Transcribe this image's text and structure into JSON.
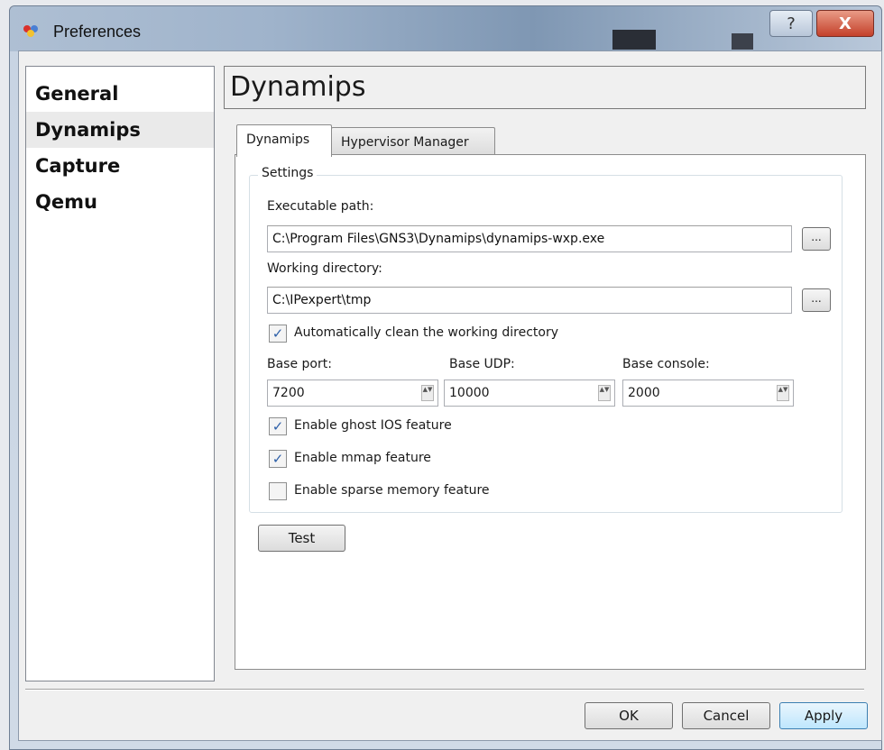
{
  "window": {
    "title": "Preferences",
    "help_glyph": "?",
    "close_glyph": "X"
  },
  "nav": {
    "items": [
      {
        "label": "General"
      },
      {
        "label": "Dynamips"
      },
      {
        "label": "Capture"
      },
      {
        "label": "Qemu"
      }
    ],
    "selected": "Dynamips"
  },
  "page": {
    "title": "Dynamips",
    "tabs": [
      {
        "label": "Dynamips"
      },
      {
        "label": "Hypervisor Manager"
      }
    ],
    "active_tab": "Dynamips"
  },
  "settings": {
    "group_title": "Settings",
    "executable_path_label": "Executable path:",
    "executable_path": "C:\\Program Files\\GNS3\\Dynamips\\dynamips-wxp.exe",
    "working_directory_label": "Working directory:",
    "working_directory": "C:\\IPexpert\\tmp",
    "browse_label": "...",
    "auto_clean_label": "Automatically clean the working directory",
    "auto_clean_checked": true,
    "base_port_label": "Base port:",
    "base_port": "7200",
    "base_udp_label": "Base UDP:",
    "base_udp": "10000",
    "base_console_label": "Base console:",
    "base_console": "2000",
    "ghost_ios_label": "Enable ghost IOS feature",
    "ghost_ios_checked": true,
    "mmap_label": "Enable mmap feature",
    "mmap_checked": true,
    "sparse_memory_label": "Enable sparse memory feature",
    "sparse_memory_checked": false,
    "check_glyph": "✓",
    "spin_glyph": "▲▼"
  },
  "buttons": {
    "test": "Test",
    "ok": "OK",
    "cancel": "Cancel",
    "apply": "Apply"
  }
}
